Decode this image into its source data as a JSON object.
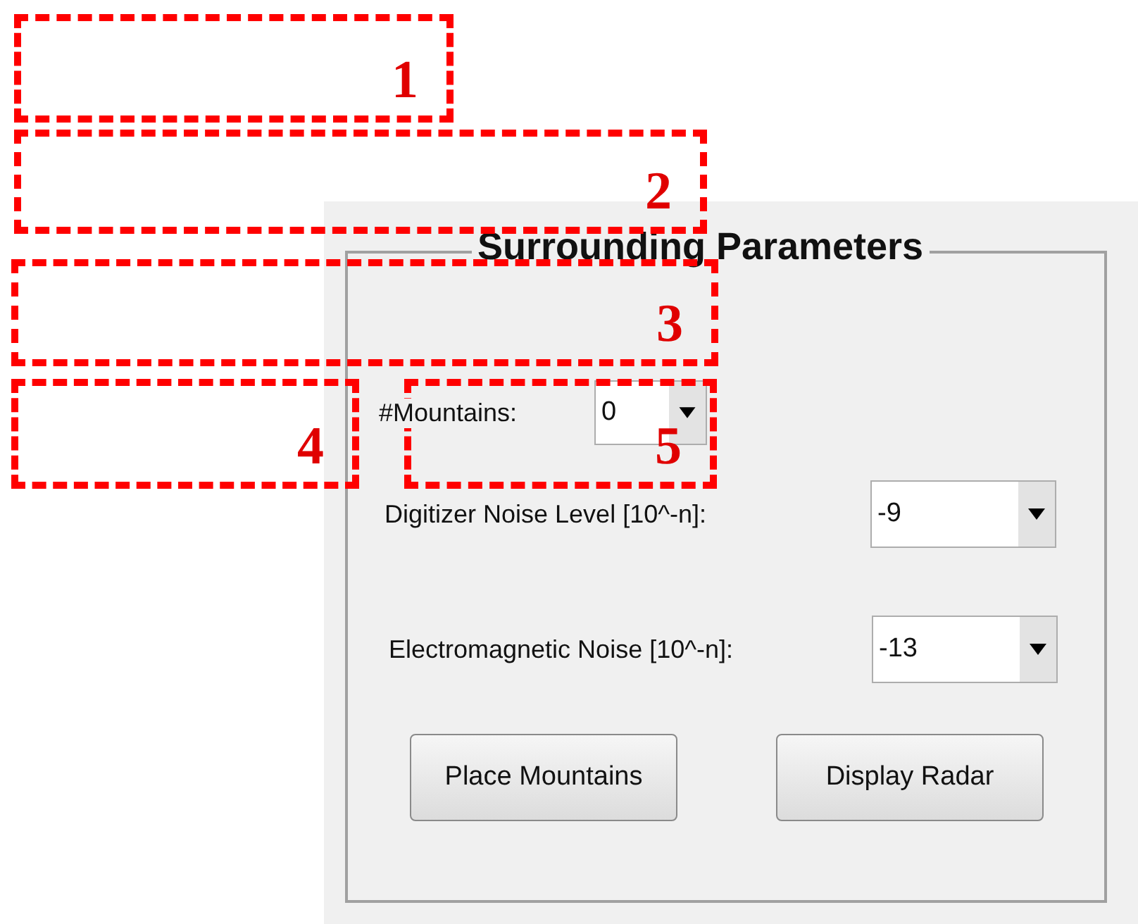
{
  "panel": {
    "title": "Surrounding Parameters",
    "fields": [
      {
        "label": "#Mountains:",
        "value": "0"
      },
      {
        "label": "Digitizer Noise Level [10^-n]:",
        "value": "-9"
      },
      {
        "label": "Electromagnetic Noise [10^-n]:",
        "value": "-13"
      }
    ],
    "buttons": [
      "Place Mountains",
      "Display Radar"
    ]
  },
  "annotations": [
    {
      "label": "1"
    },
    {
      "label": "2"
    },
    {
      "label": "3"
    },
    {
      "label": "4"
    },
    {
      "label": "5"
    }
  ]
}
